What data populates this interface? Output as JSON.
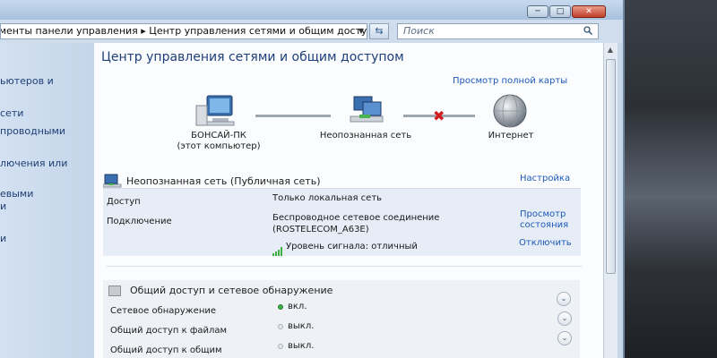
{
  "address": {
    "path": "Все элементы панели управления  ▸  Центр управления сетями и общим доступом",
    "search_placeholder": "Поиск"
  },
  "window_controls": {
    "minimize": "─",
    "maximize": "□",
    "close": "✕"
  },
  "sidebar": {
    "items": [
      "ьютеров и",
      "сети",
      "проводными",
      "лючения или",
      "евыми",
      "и",
      "и"
    ]
  },
  "page": {
    "title": "Центр управления сетями и общим доступом",
    "view_full_map": "Просмотр полной карты"
  },
  "network_map": {
    "computer_name": "БОНСАЙ-ПК",
    "computer_sub": "(этот компьютер)",
    "network_name": "Неопознанная сеть",
    "internet": "Интернет"
  },
  "active_network": {
    "title": "Неопознанная сеть (Публичная сеть)",
    "settings_link": "Настройка",
    "access_label": "Доступ",
    "access_value": "Только локальная сеть",
    "connection_label": "Подключение",
    "connection_value_line1": "Беспроводное сетевое соединение",
    "connection_value_line2": "(ROSTELECOM_A63E)",
    "signal": "Уровень сигнала: отличный",
    "view_status_line1": "Просмотр",
    "view_status_line2": "состояния",
    "disconnect": "Отключить"
  },
  "sharing": {
    "title": "Общий доступ и сетевое обнаружение",
    "rows": [
      {
        "label": "Сетевое обнаружение",
        "value": "вкл."
      },
      {
        "label": "Общий доступ к файлам",
        "value": "выкл."
      },
      {
        "label": "Общий доступ к общим",
        "value": "выкл."
      }
    ]
  },
  "colors": {
    "link": "#1d58b8",
    "status_on": "#3cb043",
    "status_off": "#a7b0ba",
    "disconnect_x": "#d11d1d"
  }
}
